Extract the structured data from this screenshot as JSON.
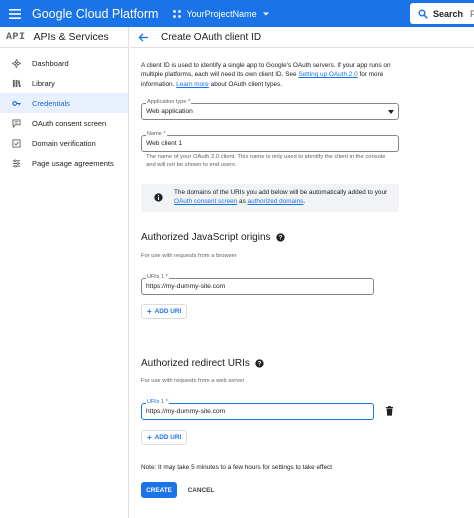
{
  "topbar": {
    "brand": "Google Cloud Platform",
    "project": "YourProjectName",
    "search_label": "Search",
    "search_suffix": "Pr",
    "color": "#1a73e8"
  },
  "sidebar": {
    "logo": "API",
    "title": "APIs & Services",
    "items": [
      {
        "label": "Dashboard",
        "icon": "dashboard-icon"
      },
      {
        "label": "Library",
        "icon": "library-icon"
      },
      {
        "label": "Credentials",
        "icon": "key-icon",
        "active": true
      },
      {
        "label": "OAuth consent screen",
        "icon": "consent-icon"
      },
      {
        "label": "Domain verification",
        "icon": "checkbox-icon"
      },
      {
        "label": "Page usage agreements",
        "icon": "settings-list-icon"
      }
    ]
  },
  "page": {
    "title": "Create OAuth client ID"
  },
  "intro": {
    "text_before": "A client ID is used to identify a single app to Google's OAuth servers. If your app runs on multiple platforms, each will need its own client ID. See ",
    "link1": "Setting up OAuth 2.0",
    "text_mid": " for more information. ",
    "link2": "Learn more",
    "text_after": " about OAuth client types."
  },
  "application_type": {
    "label": "Application type *",
    "value": "Web application"
  },
  "name_field": {
    "label": "Name *",
    "value": "Web client 1",
    "helper": "The name of your OAuth 2.0 client. This name is only used to identify the client in the console and will not be shown to end users."
  },
  "info": {
    "text_before": "The domains of the URIs you add below will be automatically added to your ",
    "link1": "OAuth consent screen",
    "text_mid": " as ",
    "link2": "authorized domains",
    "text_after": "."
  },
  "js_origins": {
    "title": "Authorized JavaScript origins",
    "subtitle": "For use with requests from a browser",
    "uri_label": "URIs 1 *",
    "uri_value": "https://my-dummy-site.com",
    "add_label": "ADD URI"
  },
  "redirect_uris": {
    "title": "Authorized redirect URIs",
    "subtitle": "For use with requests from a web server",
    "uri_label": "URIs 1 *",
    "uri_value": "https://my-dummy-site.com",
    "add_label": "ADD URI"
  },
  "note": "Note: It may take 5 minutes to a few hours for settings to take effect",
  "actions": {
    "create": "CREATE",
    "cancel": "CANCEL"
  }
}
